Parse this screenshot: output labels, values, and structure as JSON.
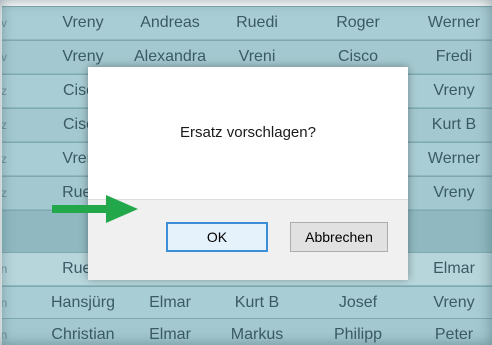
{
  "table": {
    "rows": [
      {
        "cells": [
          "Vreny",
          "Andreas",
          "Ruedi",
          "Roger",
          "Werner"
        ],
        "marker": "v"
      },
      {
        "cells": [
          "Vreny",
          "Alexandra",
          "Vreni",
          "Cisco",
          "Fredi"
        ],
        "marker": "v"
      },
      {
        "cells": [
          "Cisco",
          "",
          "",
          "",
          "Vreny"
        ],
        "marker": "z"
      },
      {
        "cells": [
          "Cisco",
          "",
          "",
          "",
          "Kurt B"
        ],
        "marker": "z"
      },
      {
        "cells": [
          "Vreny",
          "",
          "",
          "",
          "Werner"
        ],
        "marker": "z"
      },
      {
        "cells": [
          "Ruedi",
          "",
          "",
          "",
          "Vreny"
        ],
        "marker": "z"
      },
      {
        "cells": [
          "",
          "",
          "",
          "",
          ""
        ],
        "marker": ""
      },
      {
        "cells": [
          "Ruedi",
          "",
          "",
          "",
          "Elmar"
        ],
        "marker": "n"
      },
      {
        "cells": [
          "Hansjürg",
          "Elmar",
          "Kurt B",
          "Josef",
          "Vreny"
        ],
        "marker": "n"
      },
      {
        "cells": [
          "Christian",
          "Elmar",
          "Markus",
          "Philipp",
          "Peter"
        ],
        "marker": "n"
      }
    ]
  },
  "dialog": {
    "message": "Ersatz vorschlagen?",
    "ok_label": "OK",
    "cancel_label": "Abbrechen"
  },
  "annotation": {
    "arrow_color": "#22a84a",
    "icon": "green-arrow-right"
  }
}
